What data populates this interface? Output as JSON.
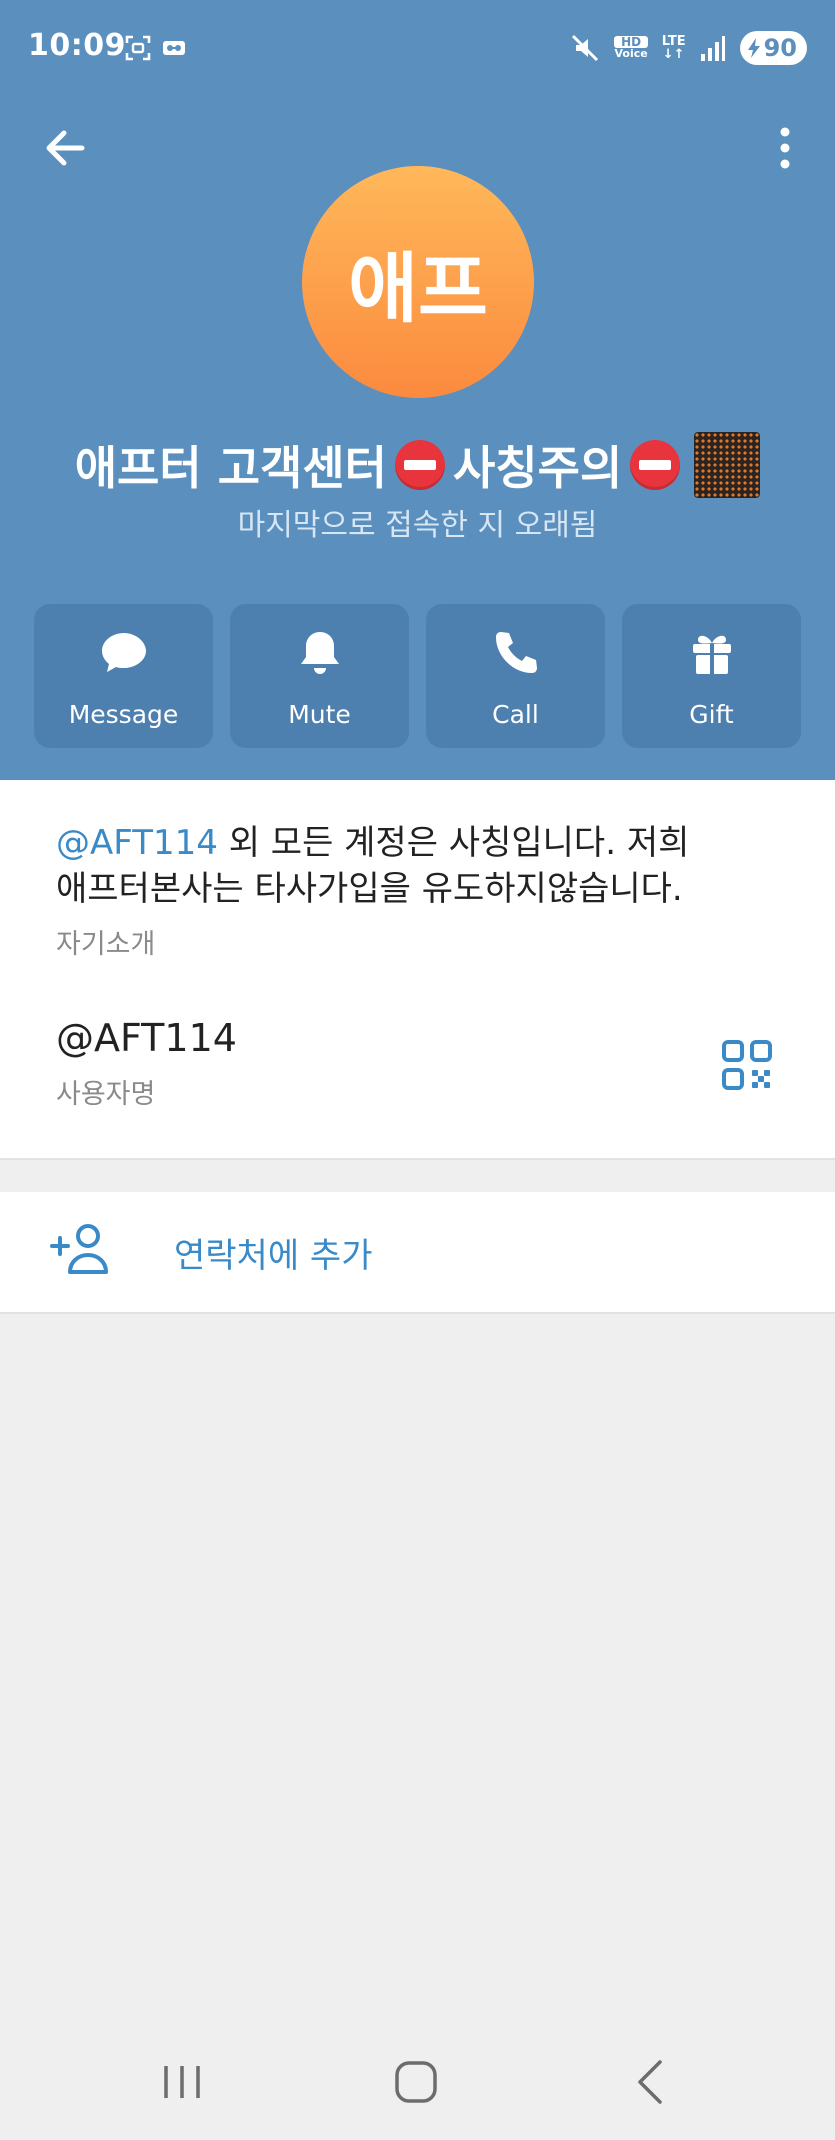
{
  "status_bar": {
    "time": "10:09",
    "hd_label": "HD",
    "voice_label": "Voice",
    "lte_label": "LTE",
    "battery_level": "90",
    "icons": [
      "screenshot-icon",
      "voicemail-icon",
      "mute-icon",
      "hd-voice-icon",
      "lte-icon",
      "signal-icon",
      "battery-charging-icon"
    ]
  },
  "top_bar": {
    "back_icon": "arrow-left-icon",
    "more_icon": "more-vertical-icon"
  },
  "profile": {
    "avatar_text": "애프",
    "name_part1": "애프터 고객센터 ",
    "name_part2": "사칭주의",
    "last_seen": "마지막으로 접속한 지 오래됨"
  },
  "actions": [
    {
      "label": "Message",
      "icon": "chat-bubble-icon"
    },
    {
      "label": "Mute",
      "icon": "bell-icon"
    },
    {
      "label": "Call",
      "icon": "phone-icon"
    },
    {
      "label": "Gift",
      "icon": "gift-icon"
    }
  ],
  "info": {
    "bio_link": "@AFT114",
    "bio_text_line1": " 외 모든 계정은 사칭입니다. 저희",
    "bio_text_line2": "애프터본사는 타사가입을 유도하지않습니다.",
    "bio_caption": "자기소개",
    "username": "@AFT114",
    "username_caption": "사용자명",
    "qr_icon": "qr-code-icon"
  },
  "add_contact": {
    "label": "연락처에 추가",
    "icon": "add-user-icon"
  },
  "nav_bar": {
    "icons": [
      "recents-icon",
      "home-icon",
      "back-icon"
    ]
  },
  "colors": {
    "header": "#5a8fbe",
    "action_button": "#4d80ae",
    "accent": "#3a8ac8",
    "avatar_top": "#ffb85a",
    "avatar_bottom": "#fb8a3e"
  }
}
